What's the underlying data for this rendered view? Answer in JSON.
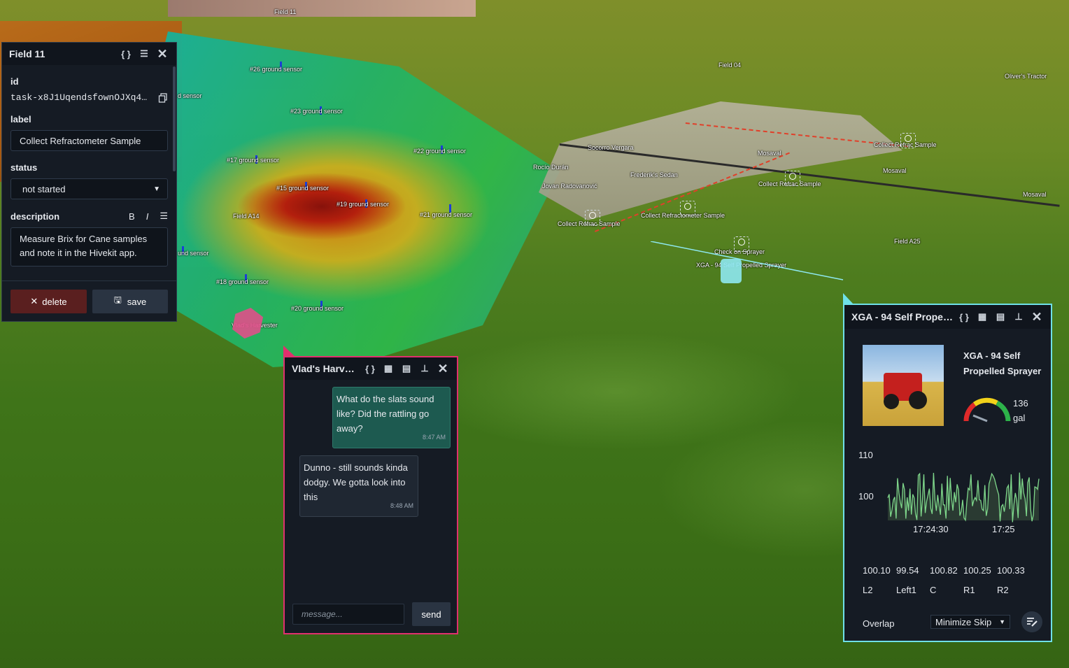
{
  "map": {
    "labels": {
      "field11": "Field 11",
      "field04": "Field 04",
      "field_a14": "Field A14",
      "field_a25": "Field A25",
      "olivers_tractor": "Oliver's Tractor",
      "s26": "#26 ground sensor",
      "s23": "#23 ground sensor",
      "s22": "#22 ground sensor",
      "s17": "#17 ground sensor",
      "s15": "#15 ground sensor",
      "s19": "#19 ground sensor",
      "s21": "#21 ground sensor",
      "s18": "#18 ground sensor",
      "s20": "#20 ground sensor",
      "partial1": "d sensor",
      "partial2": "und sensor",
      "vlads_harvester": "Vlad's Harvester",
      "collect1": "Collect Refrac Sample",
      "collect2": "Collect Refractometer Sample",
      "collect3": "Collect Refrac Sample",
      "collect4": "Collect Refrac Sample",
      "check_sprayer": "Check on Sprayer",
      "xga_label": "XGA - 94 Self Propelled Sprayer",
      "socorro": "Socorro Vergara",
      "rocio": "Rocío Durán",
      "jovan": "Jovan Radovanović",
      "frederiks": "Frederik's Sedan",
      "mosaval1": "Mosaval",
      "mosaval2": "Mosaval",
      "mosaval3": "Mosaval"
    }
  },
  "field_panel": {
    "title": "Field 11",
    "id_label": "id",
    "id_value": "task-x8J1UqendsfownOJXq4…",
    "label_label": "label",
    "label_value": "Collect Refractometer Sample",
    "status_label": "status",
    "status_value": "not started",
    "description_label": "description",
    "description_value": "Measure Brix for Cane samples and note it in the Hivekit app.",
    "delete_label": "delete",
    "save_label": "save"
  },
  "chat_panel": {
    "title": "Vlad's Harves…",
    "messages": [
      {
        "text": "What do the slats sound like? Did the rattling go away?",
        "time": "8:47 AM"
      },
      {
        "text": "Dunno - still sounds kinda dodgy. We gotta look into this",
        "time": "8:48 AM"
      }
    ],
    "input_placeholder": "message...",
    "send_label": "send"
  },
  "sprayer_panel": {
    "title": "XGA - 94 Self Propell…",
    "name": "XGA - 94 Self Propelled Sprayer",
    "tank_value": "136",
    "tank_unit": "gal",
    "chart_data": {
      "type": "line",
      "y_ticks": [
        "110",
        "100"
      ],
      "x_ticks": [
        "17:24:30",
        "17:25"
      ],
      "ylim": [
        96,
        114
      ]
    },
    "stats": [
      {
        "value": "100.10",
        "label": "L2"
      },
      {
        "value": "99.54",
        "label": "Left1"
      },
      {
        "value": "100.82",
        "label": "C"
      },
      {
        "value": "100.25",
        "label": "R1"
      },
      {
        "value": "100.33",
        "label": "R2"
      }
    ],
    "overlap_label": "Overlap",
    "mode_value": "Minimize Skip",
    "colors": {
      "border": "#6fe0e8",
      "line": "#7ed68a"
    }
  }
}
